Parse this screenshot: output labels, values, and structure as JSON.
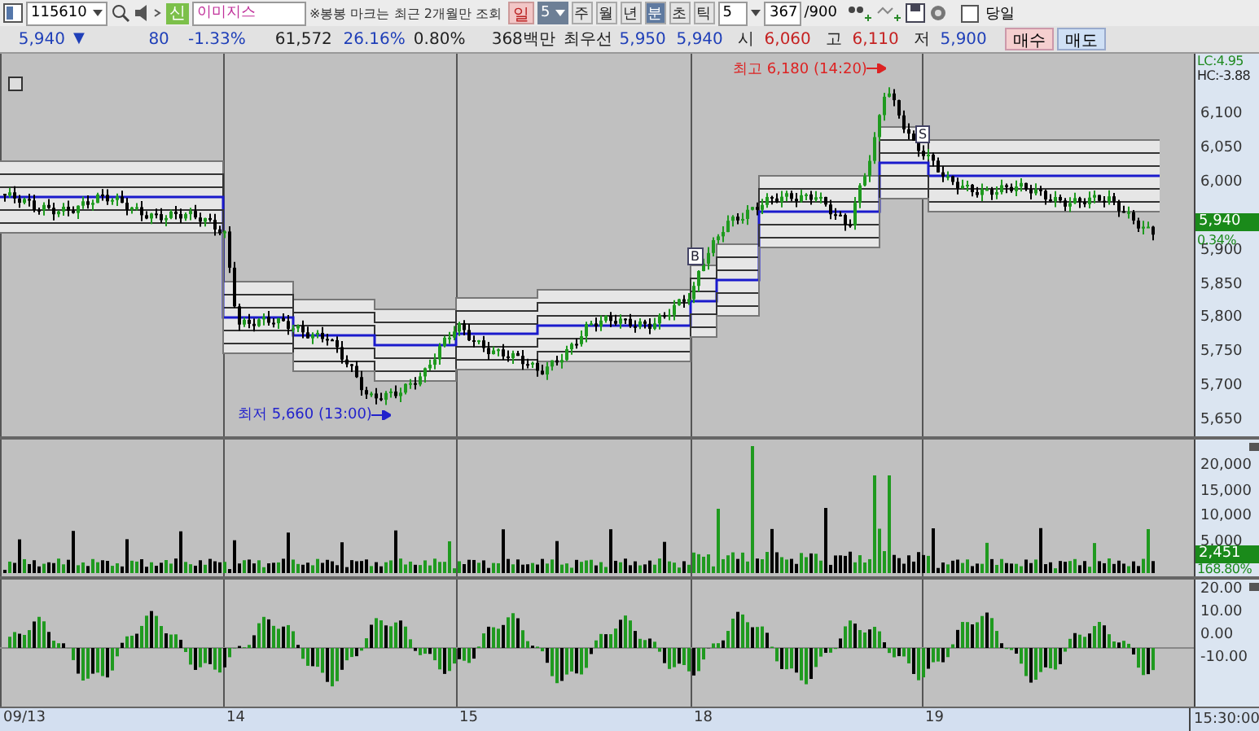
{
  "toolbar": {
    "stock_code": "115610",
    "market_badge": "신",
    "stock_name": "이미지스",
    "notice": "※봉봉 마크는 최근 2개월만 조회",
    "day_button": "일",
    "day_count": "5",
    "periods": [
      {
        "label": "주",
        "selected": false
      },
      {
        "label": "월",
        "selected": false
      },
      {
        "label": "년",
        "selected": false
      },
      {
        "label": "분",
        "selected": true
      },
      {
        "label": "초",
        "selected": false
      },
      {
        "label": "틱",
        "selected": false
      }
    ],
    "interval": "5",
    "count": "367",
    "count_max": "/900",
    "same_day": {
      "label": "당일",
      "checked": false
    }
  },
  "quote": {
    "price": "5,940",
    "direction": "▼",
    "change": "80",
    "change_rate": "-1.33%",
    "volume": "61,572",
    "turnover": "26.16%",
    "ratio": "0.80%",
    "amount": "368백만",
    "best_label": "최우선",
    "best_ask": "5,950",
    "best_bid": "5,940",
    "open_label": "시",
    "open": "6,060",
    "high_label": "고",
    "high": "6,110",
    "low_label": "저",
    "low": "5,900",
    "buy_button": "매수",
    "sell_button": "매도"
  },
  "price_panel": {
    "lc": "LC:4.95",
    "hc": "HC:-3.88",
    "ticks": [
      "6,100",
      "6,050",
      "6,000",
      "5,900",
      "5,850",
      "5,800",
      "5,750",
      "5,700",
      "5,650"
    ],
    "price_tag": "5,940",
    "change_tag": "0.34%",
    "high_note": "최고 6,180 (14:20)",
    "low_note": "최저 5,660 (13:00)",
    "buy_marker": "B",
    "sell_marker": "S"
  },
  "volume_panel": {
    "ticks": [
      "20,000",
      "15,000",
      "10,000",
      "5,000"
    ],
    "volume_tag": "2,451",
    "ratio_tag": "168.80%"
  },
  "oscillator_panel": {
    "ticks": [
      "20.00",
      "10.00",
      "0.00",
      "-10.00"
    ]
  },
  "date_axis": {
    "dates": [
      "09/13",
      "14",
      "15",
      "18",
      "19"
    ],
    "time": "15:30:00"
  }
}
